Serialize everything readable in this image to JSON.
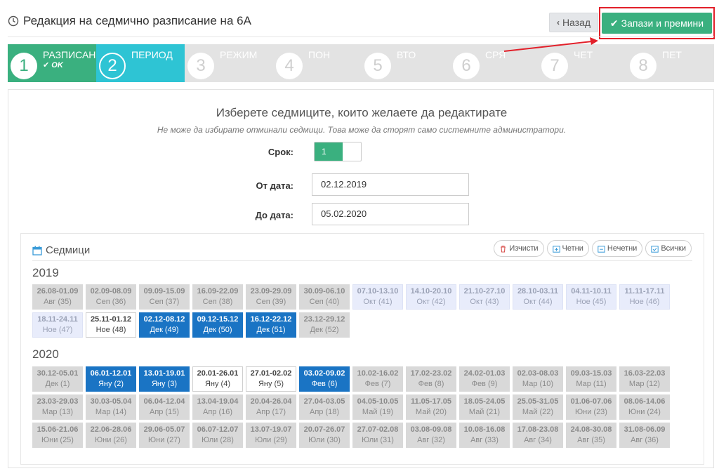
{
  "header": {
    "title": "Редакция на седмично разписание на 6А",
    "back_label": "Назад",
    "save_label": "Запази и премини"
  },
  "wizard": {
    "steps": [
      {
        "num": "1",
        "label": "РАЗПИСАН",
        "sub": "OK",
        "state": "done"
      },
      {
        "num": "2",
        "label": "ПЕРИОД",
        "sub": "",
        "state": "active"
      },
      {
        "num": "3",
        "label": "РЕЖИМ",
        "sub": "",
        "state": "todo"
      },
      {
        "num": "4",
        "label": "ПОН",
        "sub": "",
        "state": "todo"
      },
      {
        "num": "5",
        "label": "ВТО",
        "sub": "",
        "state": "todo"
      },
      {
        "num": "6",
        "label": "СРЯ",
        "sub": "",
        "state": "todo"
      },
      {
        "num": "7",
        "label": "ЧЕТ",
        "sub": "",
        "state": "todo"
      },
      {
        "num": "8",
        "label": "ПЕТ",
        "sub": "",
        "state": "todo"
      }
    ]
  },
  "form": {
    "heading": "Изберете седмиците, които желаете да редактирате",
    "subheading": "Не може да избирате отминали седмици. Това може да сторят само системните администратори.",
    "term_label": "Срок:",
    "term_value": "1",
    "from_label": "От дата:",
    "from_value": "02.12.2019",
    "to_label": "До дата:",
    "to_value": "05.02.2020"
  },
  "weeks": {
    "title": "Седмици",
    "tools": [
      "Изчисти",
      "Четни",
      "Нечетни",
      "Всички"
    ],
    "years": [
      {
        "year": "2019",
        "cells": [
          {
            "d": "26.08-01.09",
            "m": "Авг (35)",
            "s": "past"
          },
          {
            "d": "02.09-08.09",
            "m": "Сеп (36)",
            "s": "past"
          },
          {
            "d": "09.09-15.09",
            "m": "Сеп (37)",
            "s": "past"
          },
          {
            "d": "16.09-22.09",
            "m": "Сеп (38)",
            "s": "past"
          },
          {
            "d": "23.09-29.09",
            "m": "Сеп (39)",
            "s": "past"
          },
          {
            "d": "30.09-06.10",
            "m": "Сеп (40)",
            "s": "past"
          },
          {
            "d": "07.10-13.10",
            "m": "Окт (41)",
            "s": "future"
          },
          {
            "d": "14.10-20.10",
            "m": "Окт (42)",
            "s": "future"
          },
          {
            "d": "21.10-27.10",
            "m": "Окт (43)",
            "s": "future"
          },
          {
            "d": "28.10-03.11",
            "m": "Окт (44)",
            "s": "future"
          },
          {
            "d": "04.11-10.11",
            "m": "Ное (45)",
            "s": "future"
          },
          {
            "d": "11.11-17.11",
            "m": "Ное (46)",
            "s": "future"
          },
          {
            "d": "18.11-24.11",
            "m": "Ное (47)",
            "s": "future"
          },
          {
            "d": "25.11-01.12",
            "m": "Ное (48)",
            "s": "white"
          },
          {
            "d": "02.12-08.12",
            "m": "Дек (49)",
            "s": "sel"
          },
          {
            "d": "09.12-15.12",
            "m": "Дек (50)",
            "s": "sel"
          },
          {
            "d": "16.12-22.12",
            "m": "Дек (51)",
            "s": "sel"
          },
          {
            "d": "23.12-29.12",
            "m": "Дек (52)",
            "s": "past"
          }
        ]
      },
      {
        "year": "2020",
        "cells": [
          {
            "d": "30.12-05.01",
            "m": "Дек (1)",
            "s": "past"
          },
          {
            "d": "06.01-12.01",
            "m": "Яну (2)",
            "s": "sel"
          },
          {
            "d": "13.01-19.01",
            "m": "Яну (3)",
            "s": "sel"
          },
          {
            "d": "20.01-26.01",
            "m": "Яну (4)",
            "s": "white"
          },
          {
            "d": "27.01-02.02",
            "m": "Яну (5)",
            "s": "white"
          },
          {
            "d": "03.02-09.02",
            "m": "Фев (6)",
            "s": "sel"
          },
          {
            "d": "10.02-16.02",
            "m": "Фев (7)",
            "s": "past"
          },
          {
            "d": "17.02-23.02",
            "m": "Фев (8)",
            "s": "past"
          },
          {
            "d": "24.02-01.03",
            "m": "Фев (9)",
            "s": "past"
          },
          {
            "d": "02.03-08.03",
            "m": "Мар (10)",
            "s": "past"
          },
          {
            "d": "09.03-15.03",
            "m": "Мар (11)",
            "s": "past"
          },
          {
            "d": "16.03-22.03",
            "m": "Мар (12)",
            "s": "past"
          },
          {
            "d": "23.03-29.03",
            "m": "Мар (13)",
            "s": "past"
          },
          {
            "d": "30.03-05.04",
            "m": "Мар (14)",
            "s": "past"
          },
          {
            "d": "06.04-12.04",
            "m": "Апр (15)",
            "s": "past"
          },
          {
            "d": "13.04-19.04",
            "m": "Апр (16)",
            "s": "past"
          },
          {
            "d": "20.04-26.04",
            "m": "Апр (17)",
            "s": "past"
          },
          {
            "d": "27.04-03.05",
            "m": "Апр (18)",
            "s": "past"
          },
          {
            "d": "04.05-10.05",
            "m": "Май (19)",
            "s": "past"
          },
          {
            "d": "11.05-17.05",
            "m": "Май (20)",
            "s": "past"
          },
          {
            "d": "18.05-24.05",
            "m": "Май (21)",
            "s": "past"
          },
          {
            "d": "25.05-31.05",
            "m": "Май (22)",
            "s": "past"
          },
          {
            "d": "01.06-07.06",
            "m": "Юни (23)",
            "s": "past"
          },
          {
            "d": "08.06-14.06",
            "m": "Юни (24)",
            "s": "past"
          },
          {
            "d": "15.06-21.06",
            "m": "Юни (25)",
            "s": "past"
          },
          {
            "d": "22.06-28.06",
            "m": "Юни (26)",
            "s": "past"
          },
          {
            "d": "29.06-05.07",
            "m": "Юни (27)",
            "s": "past"
          },
          {
            "d": "06.07-12.07",
            "m": "Юли (28)",
            "s": "past"
          },
          {
            "d": "13.07-19.07",
            "m": "Юли (29)",
            "s": "past"
          },
          {
            "d": "20.07-26.07",
            "m": "Юли (30)",
            "s": "past"
          },
          {
            "d": "27.07-02.08",
            "m": "Юли (31)",
            "s": "past"
          },
          {
            "d": "03.08-09.08",
            "m": "Авг (32)",
            "s": "past"
          },
          {
            "d": "10.08-16.08",
            "m": "Авг (33)",
            "s": "past"
          },
          {
            "d": "17.08-23.08",
            "m": "Авг (34)",
            "s": "past"
          },
          {
            "d": "24.08-30.08",
            "m": "Авг (35)",
            "s": "past"
          },
          {
            "d": "31.08-06.09",
            "m": "Авг (36)",
            "s": "past"
          }
        ]
      }
    ]
  },
  "colors": {
    "accent_green": "#3ab07f",
    "active_cyan": "#2ec4d4",
    "selected_blue": "#1a74c4",
    "annotation_red": "#e2202a"
  }
}
